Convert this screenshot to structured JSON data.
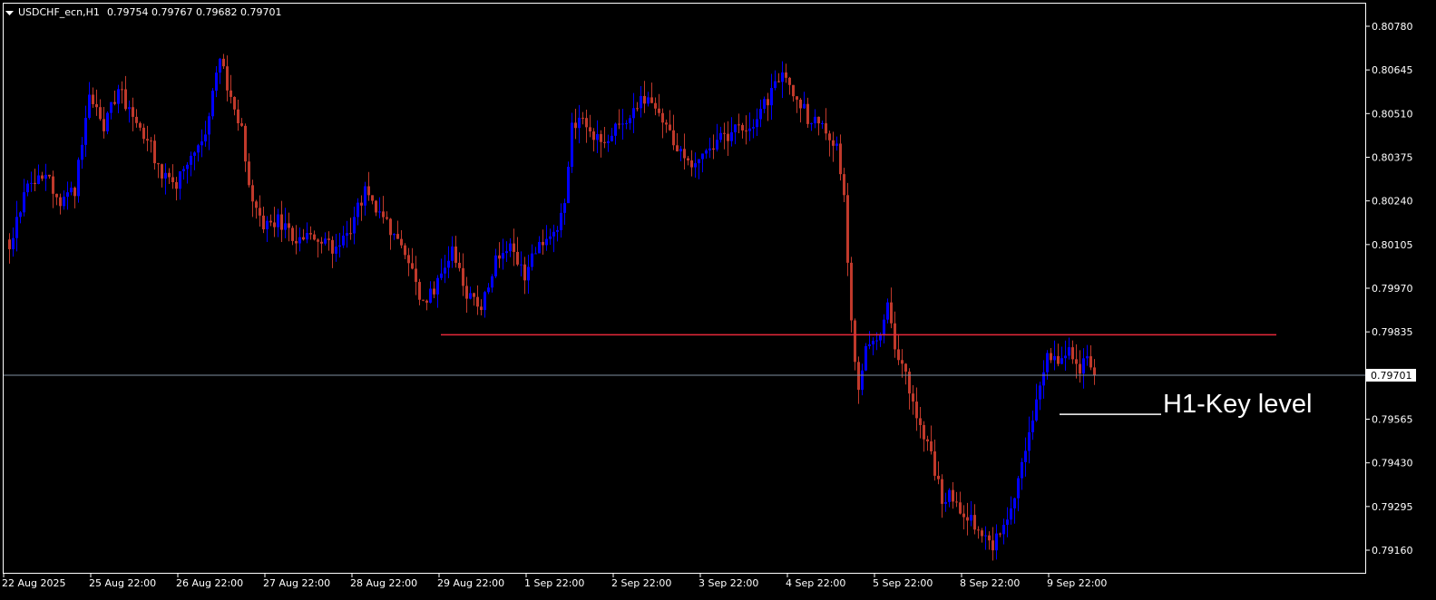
{
  "header": {
    "symbol": "USDCHF_ecn,H1",
    "ohlc": "0.79754 0.79767 0.79682 0.79701"
  },
  "colors": {
    "background": "#000000",
    "frame": "#ffffff",
    "bull": "#0000ff",
    "bear": "#c0392b",
    "key_level": "#e8283a",
    "bid_line": "#8090a0",
    "text": "#ffffff",
    "price_tag_bg": "#ffffff"
  },
  "chart_data": {
    "type": "candlestick",
    "timeframe": "H1",
    "ylim": [
      0.7909,
      0.8085
    ],
    "y_ticks": [
      "0.80780",
      "0.80645",
      "0.80510",
      "0.80375",
      "0.80240",
      "0.80105",
      "0.79970",
      "0.79835",
      "0.79565",
      "0.79430",
      "0.79295",
      "0.79160"
    ],
    "x_ticks": [
      "22 Aug 2025",
      "25 Aug 22:00",
      "26 Aug 22:00",
      "27 Aug 22:00",
      "28 Aug 22:00",
      "29 Aug 22:00",
      "1 Sep 22:00",
      "2 Sep 22:00",
      "3 Sep 22:00",
      "4 Sep 22:00",
      "5 Sep 22:00",
      "8 Sep 22:00",
      "9 Sep 22:00"
    ],
    "current_price": "0.79701",
    "key_level": {
      "price": 0.79826,
      "from": "29 Aug 22:00",
      "to": "10 Sep"
    },
    "annotation": {
      "text": "H1-Key level",
      "price": 0.7958
    },
    "anchors": [
      [
        0,
        0.8011
      ],
      [
        4,
        0.8026
      ],
      [
        9,
        0.8033
      ],
      [
        14,
        0.8024
      ],
      [
        18,
        0.8027
      ],
      [
        22,
        0.8058
      ],
      [
        26,
        0.8046
      ],
      [
        30,
        0.8059
      ],
      [
        34,
        0.8049
      ],
      [
        38,
        0.8044
      ],
      [
        42,
        0.8031
      ],
      [
        46,
        0.8029
      ],
      [
        50,
        0.8038
      ],
      [
        54,
        0.8046
      ],
      [
        58,
        0.8068
      ],
      [
        62,
        0.8052
      ],
      [
        64,
        0.8046
      ],
      [
        67,
        0.8023
      ],
      [
        70,
        0.8017
      ],
      [
        74,
        0.8018
      ],
      [
        78,
        0.8012
      ],
      [
        82,
        0.8015
      ],
      [
        86,
        0.8013
      ],
      [
        90,
        0.8008
      ],
      [
        94,
        0.8015
      ],
      [
        98,
        0.8028
      ],
      [
        102,
        0.802
      ],
      [
        106,
        0.8014
      ],
      [
        110,
        0.8006
      ],
      [
        114,
        0.7992
      ],
      [
        118,
        0.7998
      ],
      [
        122,
        0.8008
      ],
      [
        126,
        0.7994
      ],
      [
        130,
        0.7992
      ],
      [
        134,
        0.8005
      ],
      [
        138,
        0.801
      ],
      [
        142,
        0.8001
      ],
      [
        146,
        0.801
      ],
      [
        150,
        0.8013
      ],
      [
        153,
        0.8022
      ],
      [
        155,
        0.8048
      ],
      [
        158,
        0.805
      ],
      [
        162,
        0.8043
      ],
      [
        166,
        0.8045
      ],
      [
        170,
        0.805
      ],
      [
        174,
        0.8056
      ],
      [
        178,
        0.8052
      ],
      [
        182,
        0.8045
      ],
      [
        186,
        0.8038
      ],
      [
        190,
        0.8035
      ],
      [
        194,
        0.8042
      ],
      [
        198,
        0.8044
      ],
      [
        202,
        0.8047
      ],
      [
        206,
        0.8049
      ],
      [
        210,
        0.8058
      ],
      [
        213,
        0.8064
      ],
      [
        216,
        0.8058
      ],
      [
        220,
        0.805
      ],
      [
        224,
        0.8046
      ],
      [
        228,
        0.804
      ],
      [
        230,
        0.8028
      ],
      [
        232,
        0.7985
      ],
      [
        234,
        0.7966
      ],
      [
        236,
        0.7979
      ],
      [
        240,
        0.7981
      ],
      [
        242,
        0.7991
      ],
      [
        245,
        0.7975
      ],
      [
        248,
        0.7966
      ],
      [
        251,
        0.7953
      ],
      [
        254,
        0.7945
      ],
      [
        257,
        0.7932
      ],
      [
        260,
        0.7933
      ],
      [
        264,
        0.7926
      ],
      [
        268,
        0.7922
      ],
      [
        271,
        0.7918
      ],
      [
        274,
        0.7923
      ],
      [
        277,
        0.7932
      ],
      [
        280,
        0.7946
      ],
      [
        283,
        0.7962
      ],
      [
        286,
        0.7977
      ],
      [
        289,
        0.7975
      ],
      [
        292,
        0.7979
      ],
      [
        295,
        0.7972
      ],
      [
        297,
        0.7978
      ],
      [
        299,
        0.797
      ]
    ]
  }
}
